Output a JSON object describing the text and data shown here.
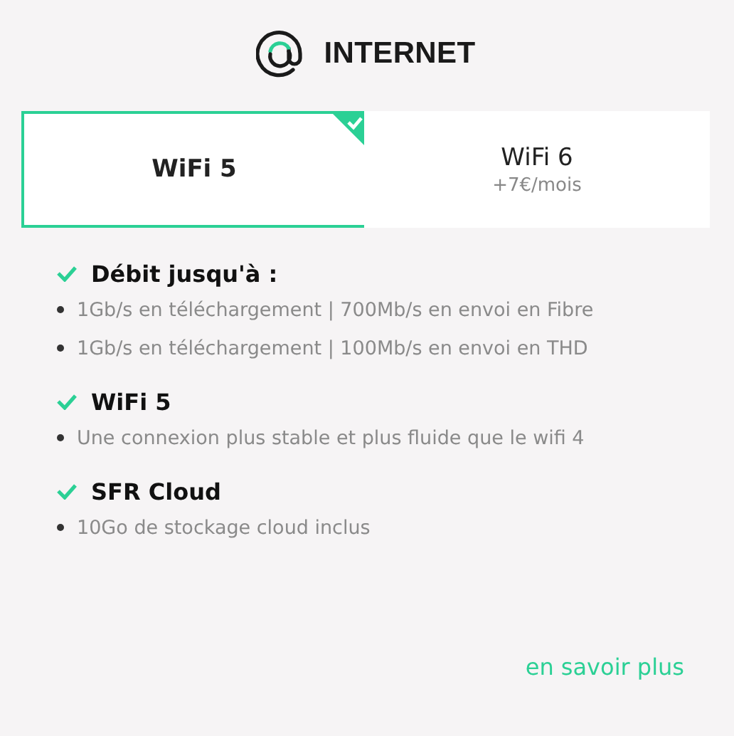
{
  "header": {
    "title": "INTERNET"
  },
  "tabs": [
    {
      "label": "WiFi 5",
      "selected": true
    },
    {
      "label": "WiFi 6",
      "price": "+7€/mois",
      "selected": false
    }
  ],
  "features": [
    {
      "title": "Débit jusqu'à :",
      "items": [
        "1Gb/s en téléchargement | 700Mb/s en envoi en Fibre",
        "1Gb/s en téléchargement | 100Mb/s en envoi en THD"
      ]
    },
    {
      "title": "WiFi 5",
      "items": [
        "Une connexion plus stable et plus fluide que le wifi 4"
      ]
    },
    {
      "title": "SFR Cloud",
      "items": [
        "10Go de stockage cloud inclus"
      ]
    }
  ],
  "link": "en savoir plus"
}
